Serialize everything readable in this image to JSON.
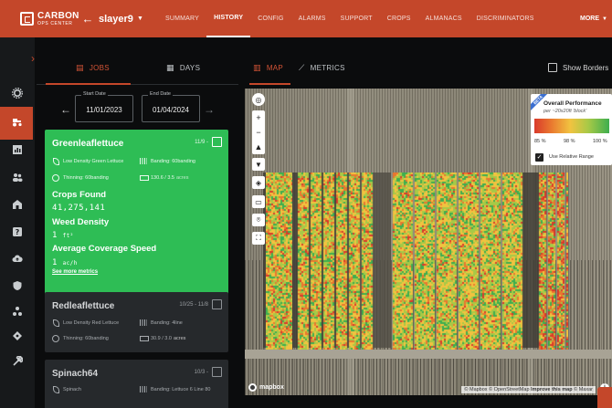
{
  "app": {
    "logo_main": "CARBON",
    "logo_sub": "OPS CENTER",
    "robot_name": "slayer9"
  },
  "nav": {
    "items": [
      "SUMMARY",
      "HISTORY",
      "CONFIG",
      "ALARMS",
      "SUPPORT",
      "CROPS",
      "ALMANACS",
      "DISCRIMINATORS"
    ],
    "active": "HISTORY",
    "more": "MORE"
  },
  "rail": {
    "icons": [
      "gear-icon",
      "tractor-icon",
      "chart-icon",
      "users-icon",
      "barn-icon",
      "help-icon",
      "cloud-icon",
      "shield-icon",
      "molecule-icon",
      "diamond-icon",
      "wrench-icon"
    ],
    "active": "tractor-icon"
  },
  "left_tabs": {
    "jobs": "JOBS",
    "days": "DAYS",
    "active": "JOBS"
  },
  "date_range": {
    "start_label": "Start Date",
    "start_value": "11/01/2023",
    "end_label": "End Date",
    "end_value": "01/04/2024"
  },
  "jobs": [
    {
      "title": "Greenleaflettuce",
      "date": "11/9 -",
      "crop": "Low Density Green Lettuce",
      "banding": "Banding: 60banding",
      "thinning": "Thinning: 60banding",
      "area": "130.6 / 3.5",
      "area_unit": "acres",
      "metrics": [
        {
          "label": "Crops Found",
          "value": "41,275,141"
        },
        {
          "label": "Weed Density",
          "value": "1",
          "unit": "ft²"
        },
        {
          "label": "Average Coverage Speed",
          "value": "1",
          "unit": "ac/h"
        }
      ],
      "see_more": "See more metrics",
      "selected": true
    },
    {
      "title": "Redleaflettuce",
      "date": "10/25 - 11/8",
      "crop": "Low Density Red Lettuce",
      "banding": "Banding: 4line",
      "thinning": "Thinning: 60banding",
      "area": "30.9 / 3.0",
      "area_unit": "acres",
      "selected": false
    },
    {
      "title": "Spinach64",
      "date": "10/3 -",
      "crop": "Spinach",
      "banding": "Banding: Lettuce 6 Line 80",
      "selected": false
    }
  ],
  "map_tabs": {
    "map": "MAP",
    "metrics": "METRICS",
    "active": "MAP",
    "show_borders": "Show Borders"
  },
  "legend": {
    "beta": "BETA",
    "title": "Overall Performance",
    "subtitle": "per ~20x20ft 'block'",
    "ticks": [
      "85 %",
      "98 %",
      "100 %"
    ],
    "relative_label": "Use Relative Range",
    "relative_checked": true,
    "colors": [
      "#d93a2b",
      "#e9772f",
      "#f1c340",
      "#a7c947",
      "#3eae4f"
    ]
  },
  "map_footer": {
    "mapbox": "mapbox",
    "attribution_1": "© Mapbox",
    "attribution_2": "© OpenStreetMap",
    "attribution_3": "Improve this map",
    "attribution_4": "© Maxar"
  },
  "colors": {
    "brand": "#c4472a",
    "active_card": "#2ebd55"
  }
}
